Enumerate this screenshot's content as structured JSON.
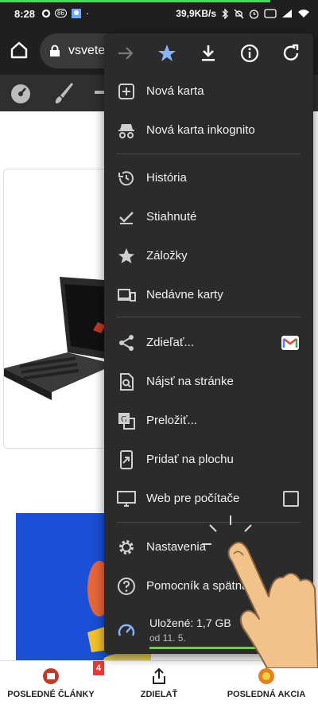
{
  "status": {
    "time": "8:28",
    "badge_num": "86",
    "net_speed": "39,9KB/s",
    "progress": 0.85
  },
  "browser": {
    "url": "vsvete"
  },
  "menu": {
    "items": [
      {
        "label": "Nová karta",
        "icon": "plus-box-icon"
      },
      {
        "label": "Nová karta inkognito",
        "icon": "incognito-icon"
      },
      {
        "label": "História",
        "icon": "history-icon"
      },
      {
        "label": "Stiahnuté",
        "icon": "download-check-icon"
      },
      {
        "label": "Záložky",
        "icon": "star-icon"
      },
      {
        "label": "Nedávne karty",
        "icon": "devices-icon"
      },
      {
        "label": "Zdieľať...",
        "icon": "share-icon"
      },
      {
        "label": "Nájsť na stránke",
        "icon": "find-icon"
      },
      {
        "label": "Preložiť...",
        "icon": "translate-icon"
      },
      {
        "label": "Pridať na plochu",
        "icon": "add-to-home-icon"
      },
      {
        "label": "Web pre počítače",
        "icon": "desktop-icon"
      },
      {
        "label": "Nastavenia",
        "icon": "gear-icon"
      },
      {
        "label": "Pomocník a spätná v",
        "icon": "help-icon"
      }
    ],
    "storage": {
      "label": "Uložené: 1,7 GB",
      "date": "od 11. 5.",
      "fill_fraction": 1.0
    }
  },
  "bottom_nav": {
    "items": [
      {
        "label": "POSLEDNÉ ČLÁNKY",
        "badge": "4"
      },
      {
        "label": "ZDIELAŤ"
      },
      {
        "label": "POSLEDNÁ AKCIA"
      }
    ]
  },
  "colors": {
    "menu_bg": "#2b2b2b",
    "star_blue": "#8ab4f8",
    "progress_green": "#3ddc5c"
  }
}
